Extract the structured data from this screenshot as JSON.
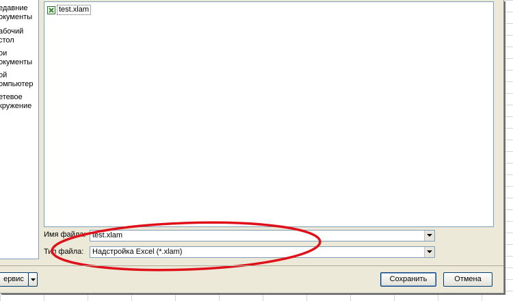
{
  "places": [
    {
      "label": "едавние\nокументы"
    },
    {
      "label": "абочий\nстол"
    },
    {
      "label": "ои\nокументы"
    },
    {
      "label": "ой\nомпьютер"
    },
    {
      "label": "етевое\nкружение"
    }
  ],
  "file_list": {
    "items": [
      {
        "name": "test.xlam",
        "icon": "excel-addin-icon"
      }
    ]
  },
  "filename": {
    "label": "Имя файла:",
    "value": "test.xlam"
  },
  "filetype": {
    "label": "Тип файла:",
    "value": "Надстройка Excel (*.xlam)"
  },
  "buttons": {
    "tools": "ервис",
    "save": "Сохранить",
    "cancel": "Отмена"
  },
  "colors": {
    "dialog_bg": "#ece9d8",
    "border": "#7f9db9",
    "annotation": "#e0101a"
  }
}
